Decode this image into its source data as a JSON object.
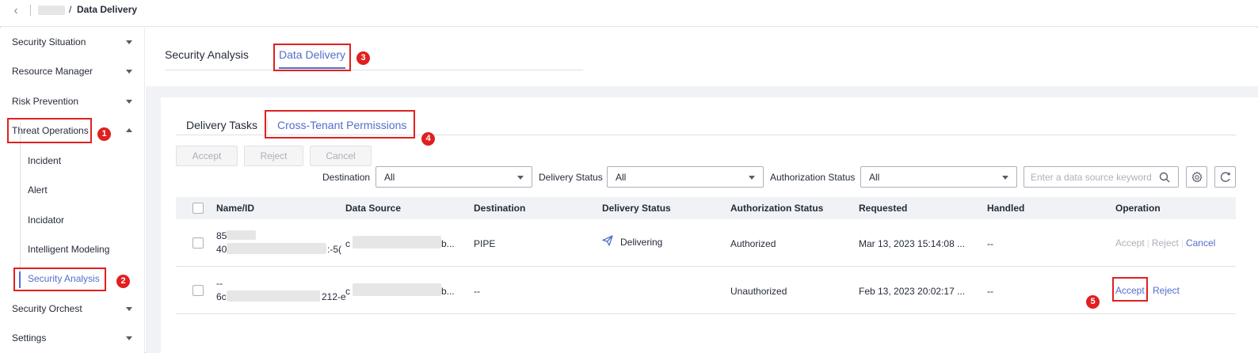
{
  "breadcrumb": {
    "current": "Data Delivery",
    "separator": "/"
  },
  "sidebar": {
    "items": [
      {
        "label": "Security Situation",
        "expanded": false
      },
      {
        "label": "Resource Manager",
        "expanded": false
      },
      {
        "label": "Risk Prevention",
        "expanded": false
      },
      {
        "label": "Threat Operations",
        "expanded": true
      },
      {
        "label": "Incident"
      },
      {
        "label": "Alert"
      },
      {
        "label": "Incidator"
      },
      {
        "label": "Intelligent Modeling"
      },
      {
        "label": "Security Analysis",
        "active": true
      },
      {
        "label": "Security Orchest",
        "expanded": false
      },
      {
        "label": "Settings",
        "expanded": false
      }
    ]
  },
  "tabs": [
    {
      "label": "Security Analysis"
    },
    {
      "label": "Data Delivery",
      "active": true
    }
  ],
  "subtabs": [
    {
      "label": "Delivery Tasks"
    },
    {
      "label": "Cross-Tenant Permissions",
      "active": true
    }
  ],
  "actions": {
    "accept": "Accept",
    "reject": "Reject",
    "cancel": "Cancel"
  },
  "filters": {
    "destination_label": "Destination",
    "destination_value": "All",
    "delivery_status_label": "Delivery Status",
    "delivery_status_value": "All",
    "authorization_status_label": "Authorization Status",
    "authorization_status_value": "All",
    "search_placeholder": "Enter a data source keyword"
  },
  "table": {
    "columns": [
      "Name/ID",
      "Data Source",
      "Destination",
      "Delivery Status",
      "Authorization Status",
      "Requested",
      "Handled",
      "Operation"
    ],
    "rows": [
      {
        "name_line1": "85",
        "name_line2": "40",
        "name_line2_tail": ":-5(",
        "data_source_head": "c",
        "data_source_tail": "b...",
        "destination": "PIPE",
        "delivery_status": "Delivering",
        "authorization_status": "Authorized",
        "requested": "Mar 13, 2023 15:14:08 ...",
        "handled": "--",
        "ops": {
          "accept": "Accept",
          "reject": "Reject",
          "cancel": "Cancel",
          "separator": "|"
        }
      },
      {
        "name_line1": "--",
        "name_line2": "6c",
        "name_line2_tail": "212-e",
        "data_source_head": "c",
        "data_source_tail": "b...",
        "destination": "--",
        "delivery_status": "",
        "authorization_status": "Unauthorized",
        "requested": "Feb 13, 2023 20:02:17 ...",
        "handled": "--",
        "ops": {
          "accept": "Accept",
          "reject": "Reject"
        }
      }
    ]
  },
  "annotations": [
    "1",
    "2",
    "3",
    "4",
    "5"
  ],
  "colors": {
    "accent": "#526ecc",
    "highlight": "#e0201f"
  }
}
